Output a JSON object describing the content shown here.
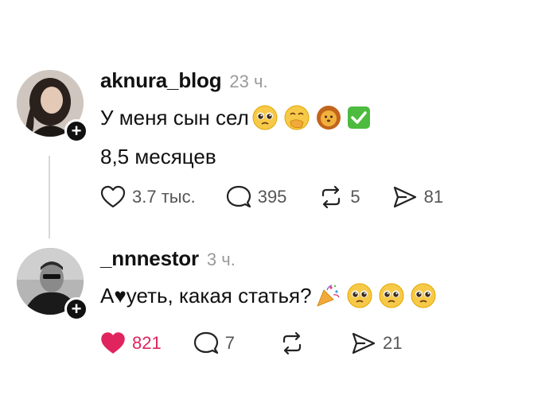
{
  "post1": {
    "username": "aknura_blog",
    "time": "23 ч.",
    "text_line1": "У меня сын сел",
    "text_line2": "8,5 месяцев",
    "likes": "3.7 тыс.",
    "comments": "395",
    "reposts": "5",
    "shares": "81",
    "emojis": [
      "pleading-face-emoji",
      "hand-over-mouth-emoji",
      "lion-face-emoji",
      "check-mark-button-emoji"
    ]
  },
  "post2": {
    "username": "_nnnestor",
    "time": "3 ч.",
    "text": "А♥уеть, какая статья?",
    "likes": "821",
    "comments": "7",
    "shares": "21",
    "emojis": [
      "party-popper-emoji",
      "pleading-face-emoji",
      "pleading-face-emoji",
      "pleading-face-emoji"
    ]
  },
  "colors": {
    "like_active": "#e0245e",
    "muted": "#9a9a9a",
    "text": "#111111"
  }
}
